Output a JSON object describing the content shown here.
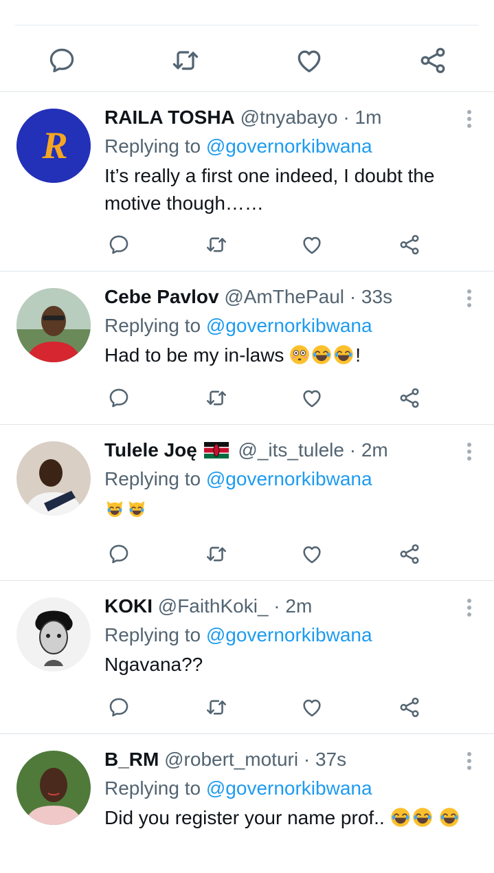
{
  "colors": {
    "accent": "#1d9bf0",
    "secondary_text": "#536471",
    "primary_text": "#0f1419",
    "divider": "#e6ecf0"
  },
  "icons": {
    "reply": "reply-icon",
    "retweet": "retweet-icon",
    "like": "like-icon",
    "share": "share-icon",
    "more": "more-options-icon"
  },
  "tweets": [
    {
      "name": "RAILA TOSHA",
      "handle": "@tnyabayo",
      "sep": "·",
      "time": "1m",
      "replying_prefix": "Replying to",
      "replying_handle": "@governorkibwana",
      "text": "It’s really a first one indeed, I doubt the motive though……"
    },
    {
      "name": "Cebe Pavlov",
      "handle": "@AmThePaul",
      "sep": "·",
      "time": "33s",
      "replying_prefix": "Replying to",
      "replying_handle": "@governorkibwana",
      "text": "Had to be my in-laws",
      "text_suffix": "!"
    },
    {
      "name": "Tulele Joę",
      "handle": "@_its_tulele",
      "sep": "·",
      "time": "2m",
      "replying_prefix": "Replying to",
      "replying_handle": "@governorkibwana",
      "text": ""
    },
    {
      "name": "KOKI",
      "handle": "@FaithKoki_",
      "sep": "·",
      "time": "2m",
      "replying_prefix": "Replying to",
      "replying_handle": "@governorkibwana",
      "text": "Ngavana??"
    },
    {
      "name": "B_RM",
      "handle": "@robert_moturi",
      "sep": "·",
      "time": "37s",
      "replying_prefix": "Replying to",
      "replying_handle": "@governorkibwana",
      "text": "Did you register your name prof.."
    }
  ]
}
